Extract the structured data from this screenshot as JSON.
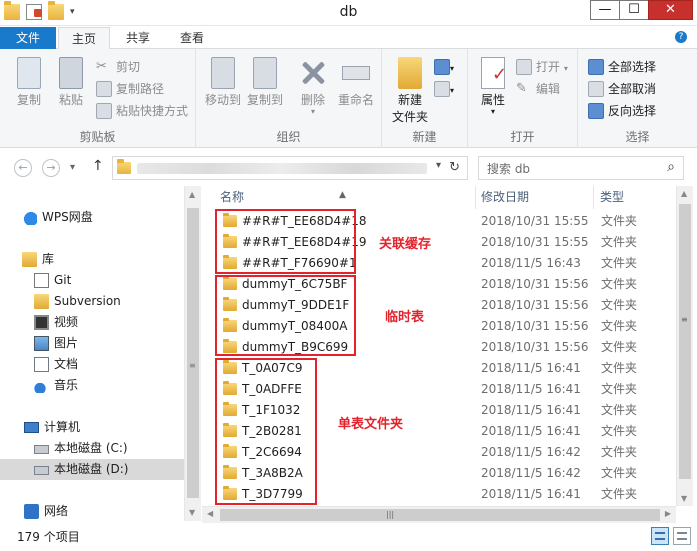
{
  "window": {
    "title": "db"
  },
  "window_controls": {
    "minimize": "—",
    "maximize": "☐",
    "close": "✕"
  },
  "tabs": {
    "file": "文件",
    "home": "主页",
    "share": "共享",
    "view": "查看"
  },
  "ribbon": {
    "clipboard": {
      "label": "剪贴板",
      "copy": "复制",
      "paste": "粘贴",
      "cut": "剪切",
      "copy_path": "复制路径",
      "paste_shortcut": "粘贴快捷方式"
    },
    "organize": {
      "label": "组织",
      "move_to": "移动到",
      "copy_to": "复制到",
      "delete": "删除",
      "rename": "重命名"
    },
    "new": {
      "label": "新建",
      "new_folder_line1": "新建",
      "new_folder_line2": "文件夹"
    },
    "open": {
      "label": "打开",
      "properties": "属性",
      "open": "打开",
      "edit": "编辑"
    },
    "select": {
      "label": "选择",
      "select_all": "全部选择",
      "select_none": "全部取消",
      "invert": "反向选择"
    }
  },
  "search": {
    "placeholder": "搜索 db"
  },
  "sidebar": {
    "items": [
      {
        "label": "WPS网盘",
        "icon": "cloud-icon"
      },
      {
        "label": "库",
        "icon": "library-icon"
      },
      {
        "label": "Git",
        "icon": "git-icon"
      },
      {
        "label": "Subversion",
        "icon": "folder-icon"
      },
      {
        "label": "视频",
        "icon": "video-icon"
      },
      {
        "label": "图片",
        "icon": "picture-icon"
      },
      {
        "label": "文档",
        "icon": "document-icon"
      },
      {
        "label": "音乐",
        "icon": "music-icon"
      },
      {
        "label": "计算机",
        "icon": "computer-icon"
      },
      {
        "label": "本地磁盘 (C:)",
        "icon": "drive-icon"
      },
      {
        "label": "本地磁盘 (D:)",
        "icon": "drive-icon",
        "selected": true
      },
      {
        "label": "网络",
        "icon": "network-icon"
      }
    ]
  },
  "columns": {
    "name": "名称",
    "modified": "修改日期",
    "type": "类型"
  },
  "files": [
    {
      "name": "##R#T_EE68D4#18",
      "modified": "2018/10/31 15:55",
      "type": "文件夹"
    },
    {
      "name": "##R#T_EE68D4#19",
      "modified": "2018/10/31 15:55",
      "type": "文件夹"
    },
    {
      "name": "##R#T_F76690#1",
      "modified": "2018/11/5 16:43",
      "type": "文件夹"
    },
    {
      "name": "dummyT_6C75BF",
      "modified": "2018/10/31 15:56",
      "type": "文件夹"
    },
    {
      "name": "dummyT_9DDE1F",
      "modified": "2018/10/31 15:56",
      "type": "文件夹"
    },
    {
      "name": "dummyT_08400A",
      "modified": "2018/10/31 15:56",
      "type": "文件夹"
    },
    {
      "name": "dummyT_B9C699",
      "modified": "2018/10/31 15:56",
      "type": "文件夹"
    },
    {
      "name": "T_0A07C9",
      "modified": "2018/11/5 16:41",
      "type": "文件夹"
    },
    {
      "name": "T_0ADFFE",
      "modified": "2018/11/5 16:41",
      "type": "文件夹"
    },
    {
      "name": "T_1F1032",
      "modified": "2018/11/5 16:41",
      "type": "文件夹"
    },
    {
      "name": "T_2B0281",
      "modified": "2018/11/5 16:41",
      "type": "文件夹"
    },
    {
      "name": "T_2C6694",
      "modified": "2018/11/5 16:42",
      "type": "文件夹"
    },
    {
      "name": "T_3A8B2A",
      "modified": "2018/11/5 16:42",
      "type": "文件夹"
    },
    {
      "name": "T_3D7799",
      "modified": "2018/11/5 16:41",
      "type": "文件夹"
    }
  ],
  "annotations": {
    "cache": "关联缓存",
    "temp": "临时表",
    "single": "单表文件夹",
    "color": "#e3232c"
  },
  "status": {
    "count": "179 个项目"
  },
  "colors": {
    "accent": "#1979ca",
    "folder": "#e8b43b"
  }
}
